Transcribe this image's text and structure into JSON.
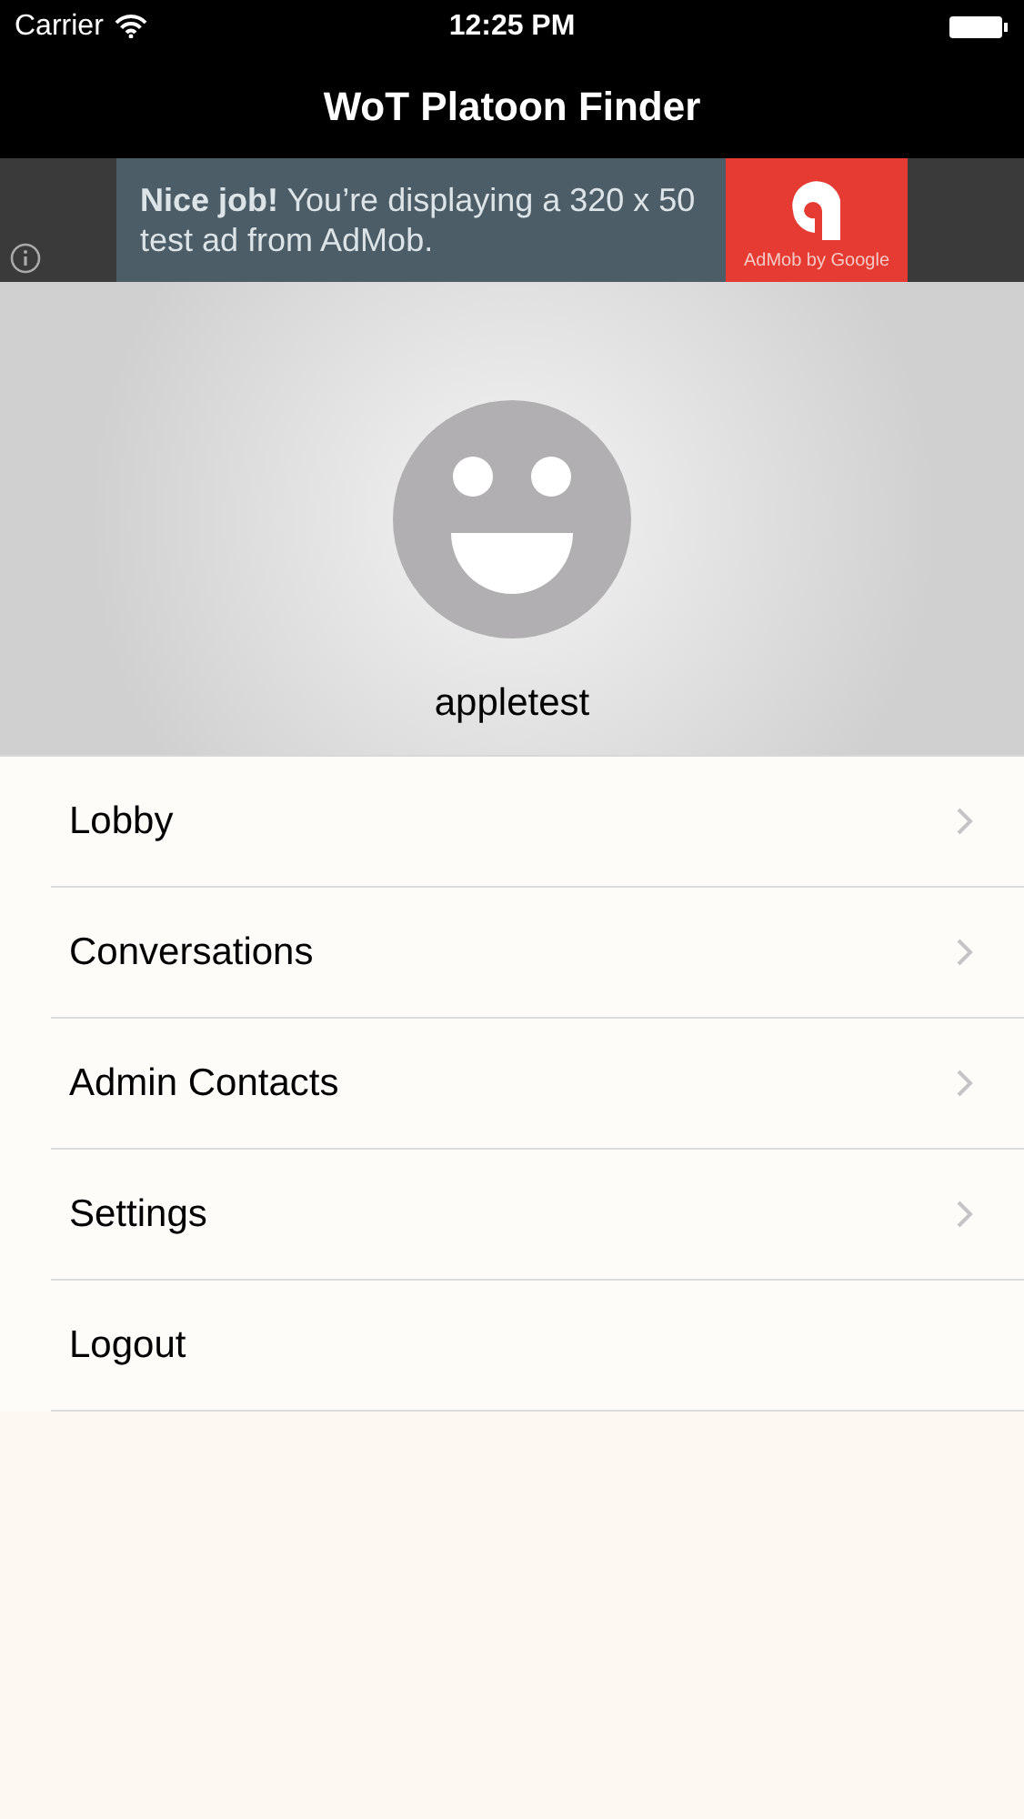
{
  "status_bar": {
    "carrier": "Carrier",
    "time": "12:25 PM"
  },
  "nav_bar": {
    "title": "WoT Platoon Finder"
  },
  "ad_banner": {
    "text": "**Nice job!** You’re displaying a 320 x 50 test ad from AdMob.",
    "brand": "AdMob by Google"
  },
  "profile": {
    "username": "appletest"
  },
  "menu": [
    {
      "label": "Lobby",
      "chevron": true
    },
    {
      "label": "Conversations",
      "chevron": true
    },
    {
      "label": "Admin Contacts",
      "chevron": true
    },
    {
      "label": "Settings",
      "chevron": true
    },
    {
      "label": "Logout",
      "chevron": false
    }
  ]
}
